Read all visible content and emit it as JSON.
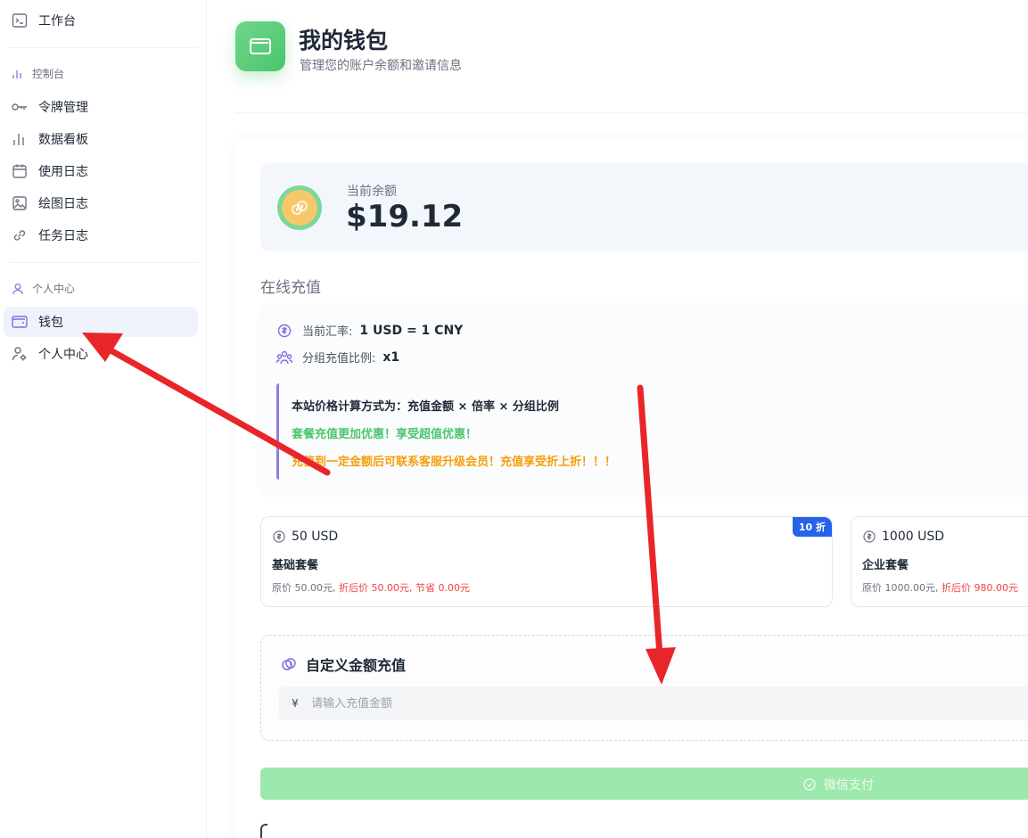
{
  "sidebar": {
    "items": [
      {
        "label": "工作台",
        "icon": "terminal-icon"
      },
      {
        "label": "令牌管理",
        "icon": "key-icon"
      },
      {
        "label": "数据看板",
        "icon": "bar-chart-icon"
      },
      {
        "label": "使用日志",
        "icon": "calendar-icon"
      },
      {
        "label": "绘图日志",
        "icon": "image-icon"
      },
      {
        "label": "任务日志",
        "icon": "link-icon"
      },
      {
        "label": "钱包",
        "icon": "wallet-icon"
      },
      {
        "label": "个人中心",
        "icon": "user-settings-icon"
      }
    ],
    "sections": [
      {
        "label": "控制台",
        "icon": "bar-chart-icon"
      },
      {
        "label": "个人中心",
        "icon": "user-icon"
      }
    ],
    "active": "钱包"
  },
  "header": {
    "title": "我的钱包",
    "subtitle": "管理您的账户余额和邀请信息"
  },
  "balance": {
    "label": "当前余额",
    "value": "$19.12"
  },
  "recharge": {
    "title": "在线充值",
    "rate_label": "当前汇率:",
    "rate_value": "1 USD = 1 CNY",
    "group_label": "分组充值比例:",
    "group_value": "x1",
    "notice_line1": "本站价格计算方式为：充值金额 × 倍率 × 分组比例",
    "notice_line2": "套餐充值更加优惠！享受超值优惠！",
    "notice_line3": "充值到一定金额后可联系客服升级会员！充值享受折上折！！！"
  },
  "packages": [
    {
      "amount": "50 USD",
      "name": "基础套餐",
      "original": "原价 50.00元,",
      "discount": "折后价 50.00元, 节省 0.00元",
      "badge": "10 折"
    },
    {
      "amount": "1000 USD",
      "name": "企业套餐",
      "original": "原价 1000.00元,",
      "discount": "折后价 980.00元",
      "badge": ""
    }
  ],
  "custom": {
    "title": "自定义金额充值",
    "currency": "¥",
    "placeholder": "请输入充值金额"
  },
  "pay_button": {
    "label": "微信支付"
  },
  "colors": {
    "accent_green": "#4cc56c",
    "accent_purple": "#7c6fd9",
    "warning_orange": "#f59e0b",
    "discount_red": "#ef4444",
    "badge_blue": "#2563eb",
    "annotation_arrow": "#e8262a"
  }
}
